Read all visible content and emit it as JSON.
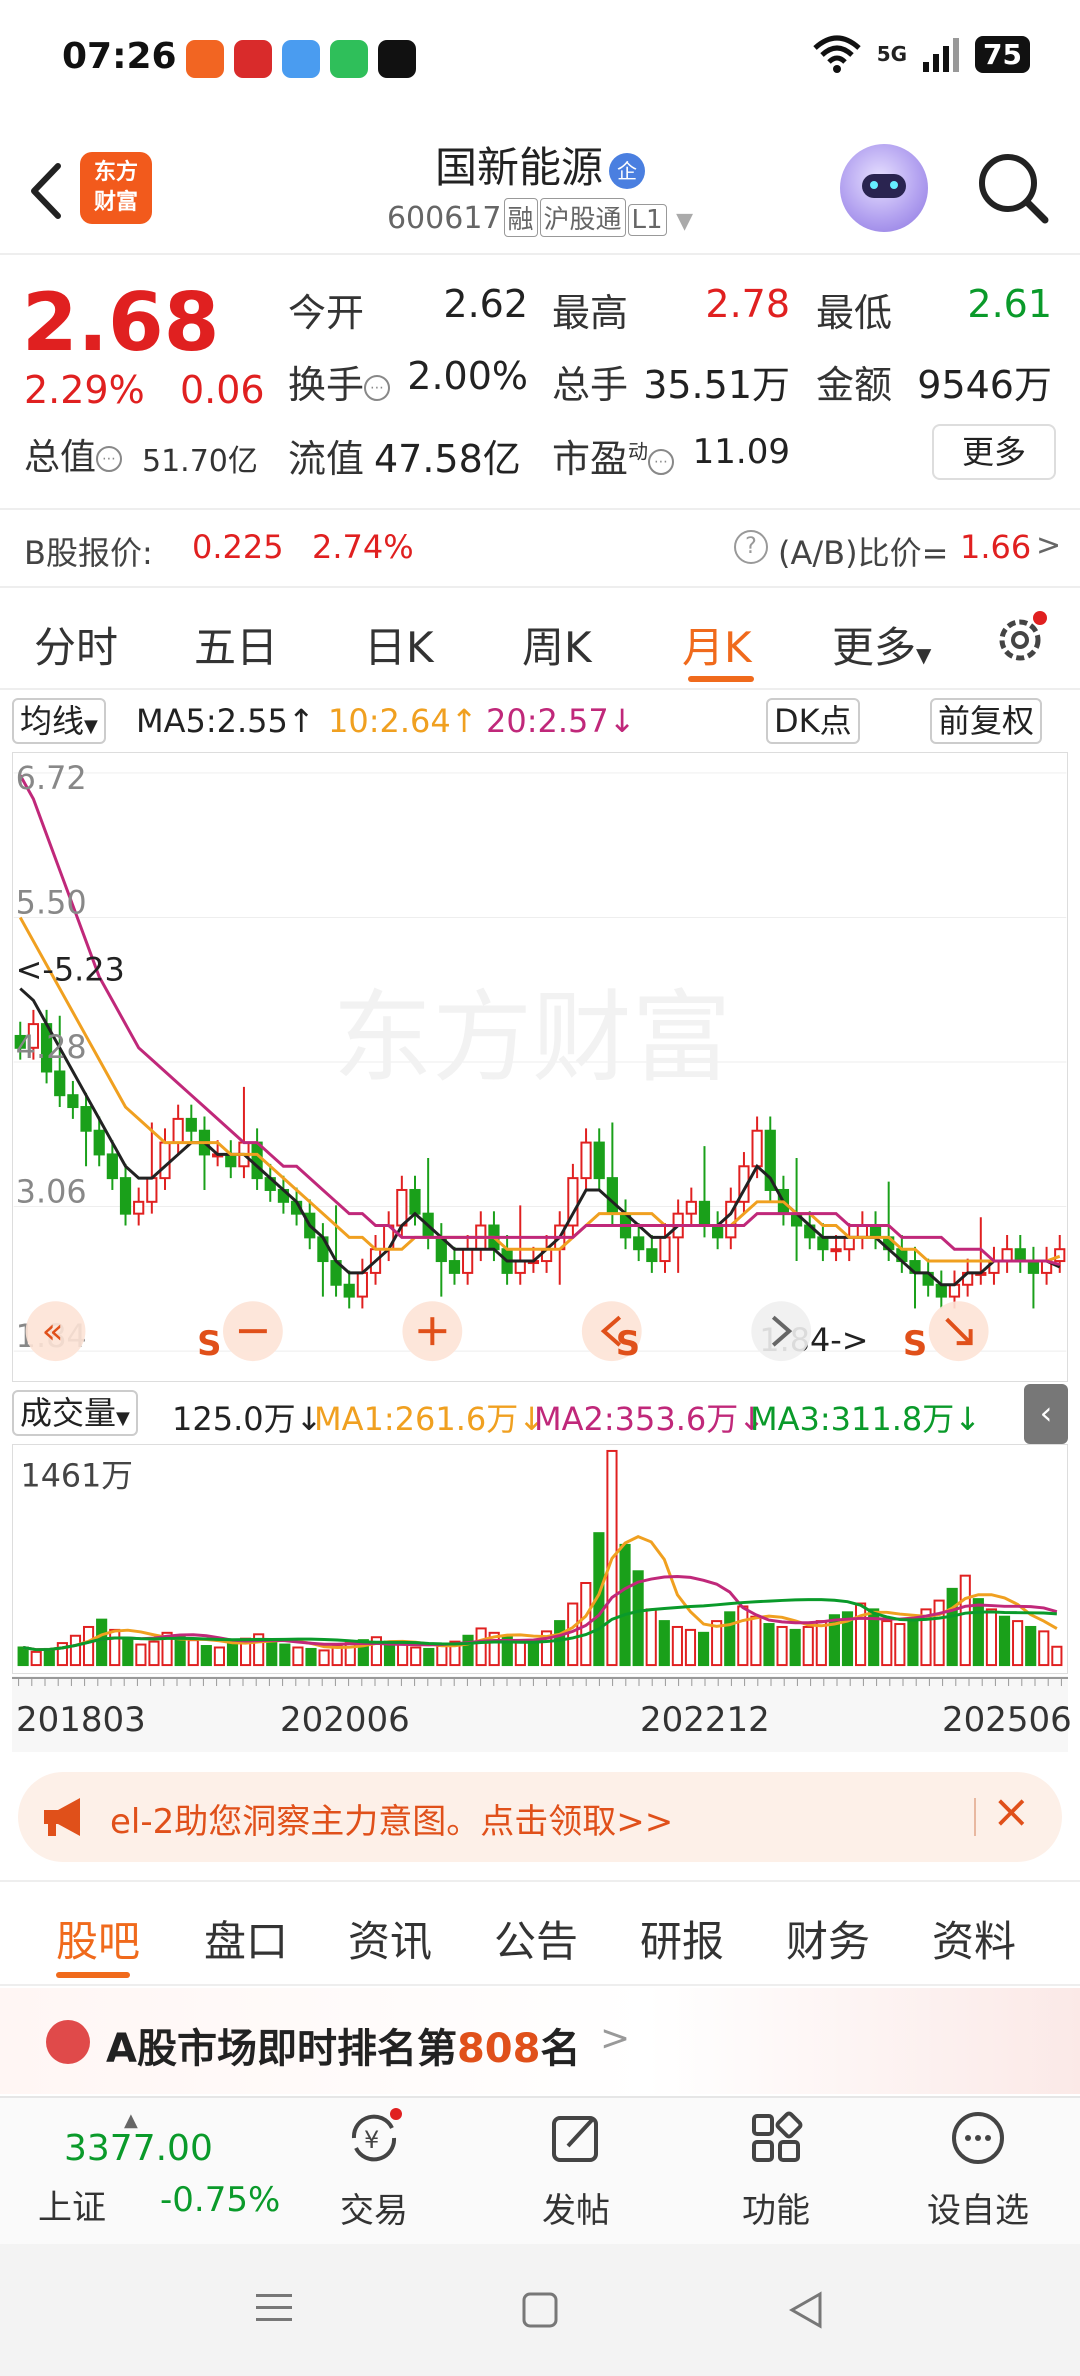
{
  "status_bar": {
    "time": "07:26",
    "network": "5G",
    "battery": "75"
  },
  "header": {
    "stock_name": "国新能源",
    "badge": "企",
    "code": "600617",
    "tags": [
      "融",
      "沪股通",
      "L1"
    ],
    "logo_text": [
      "东方",
      "财富"
    ]
  },
  "quote": {
    "price": "2.68",
    "pct_change": "2.29%",
    "change": "0.06",
    "fields": [
      {
        "label": "今开",
        "value": "2.62",
        "color": "#222222"
      },
      {
        "label": "最高",
        "value": "2.78",
        "color": "#e02020"
      },
      {
        "label": "最低",
        "value": "2.61",
        "color": "#0a9a2a"
      },
      {
        "label": "换手",
        "value": "2.00%",
        "color": "#222222"
      },
      {
        "label": "总手",
        "value": "35.51万",
        "color": "#222222"
      },
      {
        "label": "金额",
        "value": "9546万",
        "color": "#222222"
      }
    ],
    "total_value_label": "总值",
    "total_value": "51.70亿",
    "float_value_label": "流值",
    "float_value": "47.58亿",
    "pe_label": "市盈",
    "pe_sup": "动",
    "pe_value": "11.09",
    "more_label": "更多"
  },
  "b_share": {
    "label": "B股报价:",
    "price": "0.225",
    "pct": "2.74%",
    "ratio_label": "(A/B)比价=",
    "ratio_value": "1.66",
    "arrow": ">"
  },
  "tabs": [
    "分时",
    "五日",
    "日K",
    "周K",
    "月K",
    "更多"
  ],
  "active_tab": "月K",
  "ma": {
    "type_label": "均线",
    "ma5": "MA5:2.55↑",
    "ma10": "10:2.64↑",
    "ma20": "20:2.57↓",
    "dk_label": "DK点",
    "fq_label": "前复权"
  },
  "chart_data": {
    "type": "candlestick",
    "period": "monthly",
    "y_labels": [
      "6.72",
      "5.50",
      "4.28",
      "3.06",
      "1.84"
    ],
    "ylim": [
      1.84,
      6.72
    ],
    "x_labels": [
      "201803",
      "202006",
      "202212",
      "202506"
    ],
    "annotations": [
      "<-5.23",
      "1.84->"
    ],
    "signals": [
      "S",
      "S",
      "S",
      "S"
    ],
    "watermark": "东方财富",
    "closes": [
      4.4,
      4.6,
      4.2,
      4.0,
      3.9,
      3.7,
      3.5,
      3.3,
      3.0,
      3.1,
      3.3,
      3.6,
      3.8,
      3.7,
      3.5,
      3.5,
      3.4,
      3.6,
      3.3,
      3.2,
      3.1,
      3.0,
      2.8,
      2.6,
      2.4,
      2.3,
      2.5,
      2.7,
      2.9,
      3.2,
      3.0,
      2.8,
      2.6,
      2.5,
      2.7,
      2.9,
      2.7,
      2.5,
      2.6,
      2.6,
      2.7,
      2.9,
      3.3,
      3.6,
      3.3,
      3.0,
      2.8,
      2.7,
      2.6,
      2.8,
      3.0,
      3.1,
      2.9,
      2.8,
      3.1,
      3.4,
      3.7,
      3.2,
      3.0,
      2.9,
      2.8,
      2.7,
      2.7,
      2.8,
      2.9,
      2.8,
      2.7,
      2.6,
      2.5,
      2.4,
      2.3,
      2.4,
      2.5,
      2.5,
      2.6,
      2.7,
      2.6,
      2.5,
      2.6,
      2.7
    ],
    "ma5": [
      4.9,
      4.8,
      4.6,
      4.4,
      4.2,
      4.0,
      3.8,
      3.6,
      3.4,
      3.3,
      3.3,
      3.4,
      3.5,
      3.6,
      3.6,
      3.5,
      3.5,
      3.5,
      3.4,
      3.3,
      3.2,
      3.1,
      2.9,
      2.8,
      2.6,
      2.5,
      2.5,
      2.6,
      2.7,
      2.9,
      3.0,
      2.9,
      2.8,
      2.7,
      2.7,
      2.7,
      2.7,
      2.6,
      2.6,
      2.6,
      2.7,
      2.8,
      3.0,
      3.2,
      3.2,
      3.1,
      3.0,
      2.9,
      2.8,
      2.8,
      2.9,
      2.9,
      2.9,
      2.9,
      3.0,
      3.2,
      3.4,
      3.3,
      3.1,
      3.0,
      2.9,
      2.8,
      2.8,
      2.8,
      2.8,
      2.8,
      2.7,
      2.6,
      2.5,
      2.5,
      2.4,
      2.4,
      2.5,
      2.5,
      2.6,
      2.6,
      2.6,
      2.6,
      2.6,
      2.55
    ],
    "ma10": [
      5.5,
      5.3,
      5.1,
      4.9,
      4.7,
      4.5,
      4.3,
      4.1,
      3.9,
      3.8,
      3.7,
      3.6,
      3.6,
      3.6,
      3.6,
      3.6,
      3.5,
      3.5,
      3.5,
      3.4,
      3.3,
      3.2,
      3.1,
      3.0,
      2.9,
      2.8,
      2.8,
      2.7,
      2.7,
      2.7,
      2.8,
      2.8,
      2.8,
      2.8,
      2.8,
      2.8,
      2.8,
      2.7,
      2.7,
      2.7,
      2.7,
      2.7,
      2.8,
      2.9,
      3.0,
      3.0,
      3.0,
      3.0,
      3.0,
      2.9,
      2.9,
      2.9,
      2.9,
      2.9,
      2.9,
      3.0,
      3.1,
      3.1,
      3.1,
      3.0,
      3.0,
      2.9,
      2.9,
      2.8,
      2.8,
      2.8,
      2.8,
      2.7,
      2.7,
      2.6,
      2.6,
      2.6,
      2.6,
      2.6,
      2.6,
      2.6,
      2.6,
      2.6,
      2.6,
      2.64
    ],
    "ma20": [
      6.7,
      6.5,
      6.2,
      5.9,
      5.6,
      5.3,
      5.0,
      4.8,
      4.6,
      4.4,
      4.3,
      4.2,
      4.1,
      4.0,
      3.9,
      3.8,
      3.7,
      3.6,
      3.6,
      3.5,
      3.4,
      3.4,
      3.3,
      3.2,
      3.1,
      3.0,
      3.0,
      2.9,
      2.9,
      2.8,
      2.8,
      2.8,
      2.8,
      2.8,
      2.8,
      2.8,
      2.8,
      2.8,
      2.8,
      2.8,
      2.8,
      2.8,
      2.8,
      2.9,
      2.9,
      2.9,
      2.9,
      2.9,
      2.9,
      2.9,
      2.9,
      2.9,
      2.9,
      2.9,
      2.9,
      2.9,
      3.0,
      3.0,
      3.0,
      3.0,
      3.0,
      3.0,
      3.0,
      2.9,
      2.9,
      2.9,
      2.9,
      2.8,
      2.8,
      2.8,
      2.8,
      2.7,
      2.7,
      2.7,
      2.6,
      2.6,
      2.6,
      2.6,
      2.6,
      2.57
    ]
  },
  "volume": {
    "label": "成交量",
    "current": "125.0万↓",
    "ma1": "MA1:261.6万↓",
    "ma2": "MA2:353.6万↓",
    "ma3": "MA3:311.8万↓",
    "max_label": "1461万",
    "values": [
      120,
      90,
      110,
      150,
      200,
      260,
      310,
      240,
      180,
      140,
      160,
      220,
      190,
      170,
      130,
      120,
      150,
      180,
      210,
      160,
      140,
      120,
      110,
      100,
      130,
      150,
      170,
      190,
      160,
      140,
      120,
      110,
      130,
      160,
      200,
      250,
      220,
      190,
      170,
      160,
      230,
      300,
      420,
      560,
      900,
      1461,
      820,
      640,
      380,
      300,
      260,
      240,
      220,
      300,
      360,
      400,
      330,
      280,
      260,
      240,
      260,
      300,
      340,
      360,
      420,
      380,
      300,
      280,
      320,
      380,
      440,
      520,
      610,
      450,
      380,
      330,
      300,
      260,
      230,
      125
    ],
    "colors": [
      "g",
      "r",
      "g",
      "r",
      "r",
      "r",
      "g",
      "r",
      "g",
      "r",
      "r",
      "r",
      "g",
      "r",
      "g",
      "r",
      "g",
      "r",
      "r",
      "g",
      "g",
      "r",
      "g",
      "r",
      "r",
      "r",
      "g",
      "r",
      "g",
      "r",
      "r",
      "g",
      "r",
      "r",
      "g",
      "r",
      "r",
      "g",
      "r",
      "g",
      "r",
      "g",
      "r",
      "r",
      "g",
      "r",
      "g",
      "g",
      "r",
      "g",
      "r",
      "r",
      "g",
      "r",
      "g",
      "r",
      "r",
      "g",
      "r",
      "g",
      "r",
      "r",
      "g",
      "g",
      "r",
      "g",
      "r",
      "r",
      "g",
      "r",
      "r",
      "g",
      "r",
      "g",
      "r",
      "g",
      "r",
      "g",
      "r",
      "r"
    ]
  },
  "banner": {
    "text": "el-2助您洞察主力意图。点击领取>>"
  },
  "section_tabs": [
    "股吧",
    "盘口",
    "资讯",
    "公告",
    "研报",
    "财务",
    "资料"
  ],
  "active_section": "股吧",
  "rank": {
    "prefix": "A股市场即时排名第",
    "number": "808",
    "suffix": "名",
    "arrow": ">"
  },
  "toolbar": {
    "index_value": "3377.00",
    "index_name": "上证",
    "index_change": "-0.75%",
    "items": [
      "交易",
      "发帖",
      "功能",
      "设自选"
    ]
  }
}
